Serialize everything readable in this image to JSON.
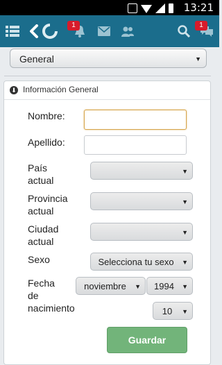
{
  "status_bar": {
    "time": "13:21",
    "battery_icon": "battery-icon",
    "signal_icon": "signal-icon",
    "wifi_icon": "wifi-icon"
  },
  "app_bar": {
    "menu_icon": "menu-icon",
    "back_icon": "back-icon",
    "logo_icon": "logo-icon",
    "notifications_badge": "1",
    "messages_badge": "1",
    "background": "#1b6d8c"
  },
  "section_select": {
    "value": "General"
  },
  "panel": {
    "title": "Información General",
    "fields": {
      "nombre_label": "Nombre:",
      "nombre_value": "",
      "apellido_label": "Apellido:",
      "apellido_value": "",
      "pais_label_1": "País",
      "pais_label_2": "actual",
      "pais_value": "",
      "provincia_label_1": "Provincia",
      "provincia_label_2": "actual",
      "provincia_value": "",
      "ciudad_label_1": "Ciudad",
      "ciudad_label_2": "actual",
      "ciudad_value": "",
      "sexo_label": "Sexo",
      "sexo_value": "Selecciona tu sexo",
      "fecha_label_1": "Fecha",
      "fecha_label_2": "de",
      "fecha_label_3": "nacimiento",
      "month_value": "noviembre",
      "year_value": "1994",
      "day_value": "10"
    },
    "save_label": "Guardar"
  },
  "colors": {
    "accent": "#1b6d8c",
    "save_button": "#72b47a",
    "badge": "#d71b2b"
  }
}
